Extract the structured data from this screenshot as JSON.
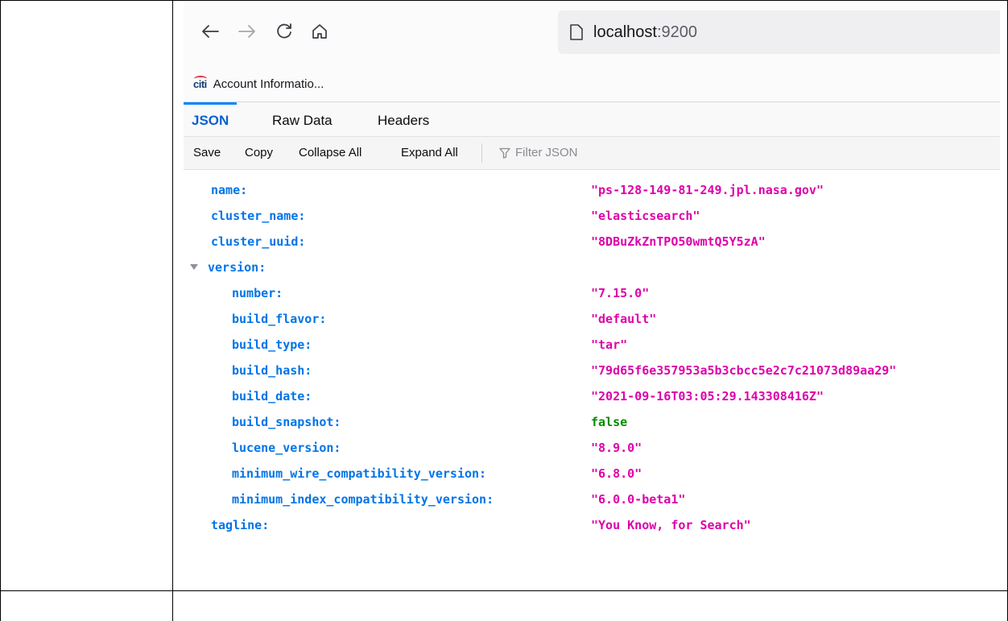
{
  "browser": {
    "url_host": "localhost",
    "url_port": ":9200",
    "bookmark_label": "Account Informatio...",
    "bookmark_logo_text": "citi"
  },
  "viewer": {
    "tabs": [
      {
        "label": "JSON",
        "active": true
      },
      {
        "label": "Raw Data",
        "active": false
      },
      {
        "label": "Headers",
        "active": false
      }
    ],
    "toolbar": {
      "save": "Save",
      "copy": "Copy",
      "collapse_all": "Collapse All",
      "expand_all": "Expand All",
      "filter_placeholder": "Filter JSON"
    }
  },
  "json": {
    "rows": [
      {
        "key": "name:",
        "value": "\"ps-128-149-81-249.jpl.nasa.gov\"",
        "type": "string"
      },
      {
        "key": "cluster_name:",
        "value": "\"elasticsearch\"",
        "type": "string"
      },
      {
        "key": "cluster_uuid:",
        "value": "\"8DBuZkZnTPO50wmtQ5Y5zA\"",
        "type": "string"
      },
      {
        "key": "version:",
        "value": "",
        "type": "object"
      },
      {
        "key": "number:",
        "value": "\"7.15.0\"",
        "type": "string"
      },
      {
        "key": "build_flavor:",
        "value": "\"default\"",
        "type": "string"
      },
      {
        "key": "build_type:",
        "value": "\"tar\"",
        "type": "string"
      },
      {
        "key": "build_hash:",
        "value": "\"79d65f6e357953a5b3cbcc5e2c7c21073d89aa29\"",
        "type": "string"
      },
      {
        "key": "build_date:",
        "value": "\"2021-09-16T03:05:29.143308416Z\"",
        "type": "string"
      },
      {
        "key": "build_snapshot:",
        "value": "false",
        "type": "boolean"
      },
      {
        "key": "lucene_version:",
        "value": "\"8.9.0\"",
        "type": "string"
      },
      {
        "key": "minimum_wire_compatibility_version:",
        "value": "\"6.8.0\"",
        "type": "string"
      },
      {
        "key": "minimum_index_compatibility_version:",
        "value": "\"6.0.0-beta1\"",
        "type": "string"
      },
      {
        "key": "tagline:",
        "value": "\"You Know, for Search\"",
        "type": "string"
      }
    ]
  },
  "colors": {
    "json_key": "#0074e8",
    "json_string": "#dd00a9",
    "json_boolean": "#058b00",
    "active_tab": "#0a60cf"
  }
}
